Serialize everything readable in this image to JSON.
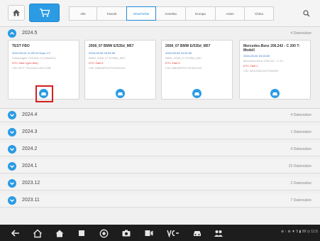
{
  "topbar": {
    "tabs": [
      {
        "label": "Alle"
      },
      {
        "label": "Favorit"
      },
      {
        "label": "Geschichte",
        "active": true
      },
      {
        "label": "Amerika"
      },
      {
        "label": "Europa"
      },
      {
        "label": "Asien"
      },
      {
        "label": "China"
      }
    ]
  },
  "expanded_section": {
    "label": "2024.5",
    "count": "4 Datensätze",
    "cards": [
      {
        "title": "TEST FBO",
        "date": "2024-05-24 11:29:04 Scan 1.0",
        "vehicle": "Volkswagen TIGUAN 2.0 (5N/AD1)",
        "dtc": "DTC Zahl:1(pre-test)",
        "vin": "VIN: WVT TIGUAN2.0AD1TAB"
      },
      {
        "title": "2008_07 BMW E/535d_M57",
        "date": "2024-05-08 16:06:59",
        "vehicle": "BMW_2008_07 E/535d_M57",
        "dtc": "DTC Zahl:3",
        "vin": "VIN: WBANP91070CE61610"
      },
      {
        "title": "2008_07 BMW E/535d_M57",
        "date": "2024-05-08 14:32:35",
        "vehicle": "BMW_2008_07 E/535d_M57",
        "dtc": "DTC Zahl:3",
        "vin": "VIN: WBANP91070CE61610"
      },
      {
        "title": "Mercedes-Benz 206.242 - C 200 T-Modell",
        "date": "2024-05-06 15:18:00",
        "vehicle": "Mercedes-Benz 206.242 - C 20...",
        "dtc": "DTC Zahl:1",
        "vin": "VIN: W1K2062421F002890"
      }
    ]
  },
  "rows": [
    {
      "label": "2024.4",
      "count": "4 Datensätze"
    },
    {
      "label": "2024.3",
      "count": "1 Datensätze"
    },
    {
      "label": "2024.2",
      "count": "4 Datensätze"
    },
    {
      "label": "2024.1",
      "count": "23 Datensätze"
    },
    {
      "label": "2023.12",
      "count": "2 Datensätze"
    },
    {
      "label": "2023.11",
      "count": "7 Datensätze"
    }
  ],
  "status": {
    "text": "⊕ ↑ ⊕ ▼ 5 ▮ 99 ◷ 11:5"
  },
  "colors": {
    "accent": "#2b9be4",
    "highlight_box": "#d51e1e",
    "dtc_text": "#e23a3a",
    "date_text": "#2b73c7",
    "navbar": "#1d1d1d"
  }
}
